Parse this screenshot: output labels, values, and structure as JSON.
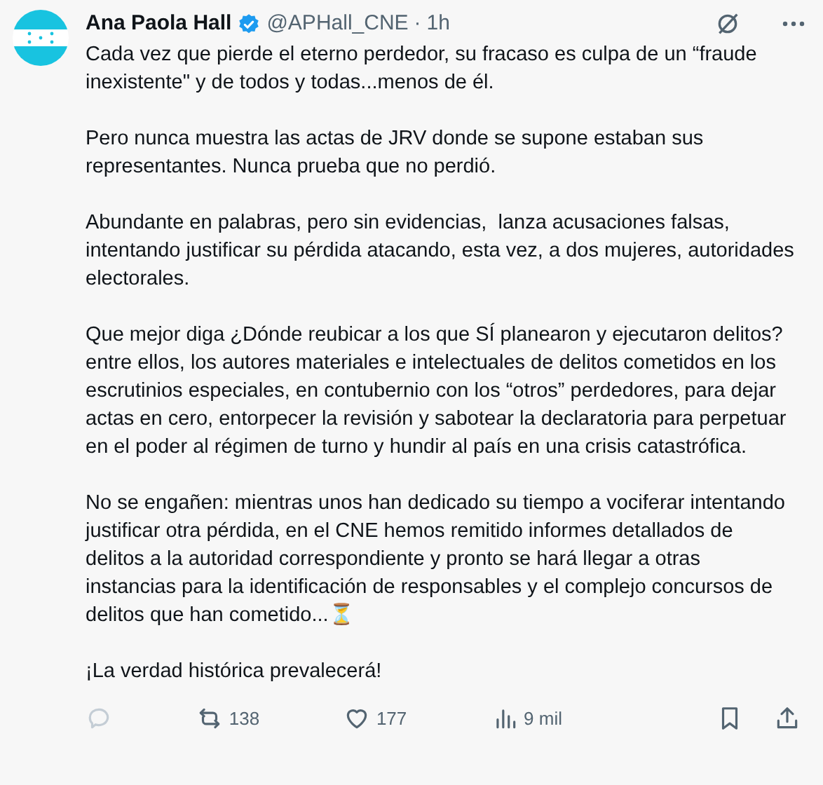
{
  "author": {
    "name": "Ana Paola Hall",
    "verified": true,
    "handle": "@APHall_CNE",
    "separator": "·",
    "time": "1h"
  },
  "paragraphs": [
    "Cada vez que pierde el eterno perdedor, su fracaso es culpa de un “fraude inexistente\" y de todos y todas...menos de él.",
    "Pero nunca muestra las actas de JRV donde se supone estaban sus representantes. Nunca prueba que no perdió.",
    "Abundante en palabras, pero sin evidencias,  lanza acusaciones falsas, intentando justificar su pérdida atacando, esta vez, a dos mujeres, autoridades electorales.",
    "Que mejor diga ¿Dónde reubicar a los que SÍ planearon y ejecutaron delitos? entre ellos, los autores materiales e intelectuales de delitos cometidos en los escrutinios especiales, en contubernio con los “otros” perdedores, para dejar actas en cero, entorpecer la revisión y sabotear la declaratoria para perpetuar en el poder al régimen de turno y hundir al país en una crisis catastrófica.",
    "No se engañen: mientras unos han dedicado su tiempo a vociferar intentando justificar otra pérdida, en el CNE hemos remitido informes detallados de delitos a la autoridad correspondiente y pronto se hará llegar a otras instancias para la identificación de responsables y el complejo concursos de delitos que han cometido...⏳",
    "¡La verdad histórica prevalecerá!"
  ],
  "actions": [
    {
      "kind": "reply"
    },
    {
      "kind": "repost",
      "count": "138"
    },
    {
      "kind": "like",
      "count": "177"
    },
    {
      "kind": "views",
      "count": "9 mil"
    },
    {
      "kind": "bookmark"
    },
    {
      "kind": "share"
    }
  ]
}
